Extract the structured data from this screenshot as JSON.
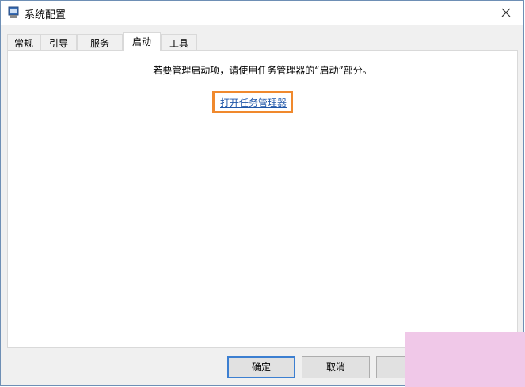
{
  "window": {
    "title": "系统配置"
  },
  "tabs": [
    {
      "label": "常规",
      "active": false
    },
    {
      "label": "引导",
      "active": false
    },
    {
      "label": "服务",
      "active": false
    },
    {
      "label": "启动",
      "active": true
    },
    {
      "label": "工具",
      "active": false
    }
  ],
  "startup": {
    "message": "若要管理启动项，请使用任务管理器的“启动”部分。",
    "link_label": "打开任务管理器"
  },
  "buttons": {
    "ok": "确定",
    "cancel": "取消"
  },
  "colors": {
    "highlight_border": "#f0892d",
    "link": "#1f56a8",
    "default_button_border": "#3c7fd1"
  }
}
